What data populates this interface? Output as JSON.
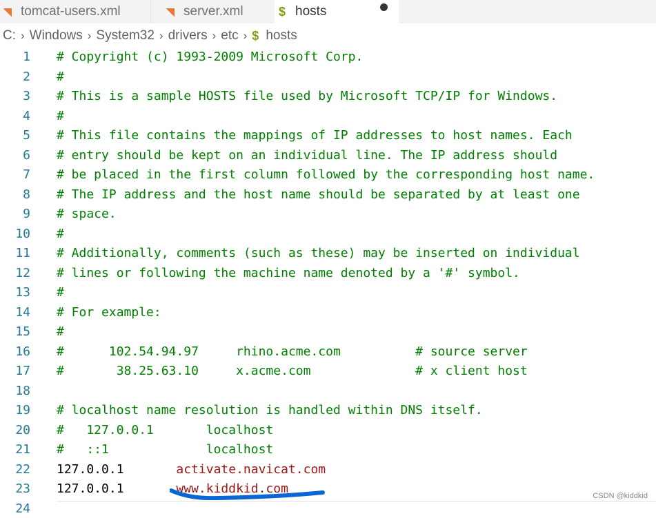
{
  "tabs": [
    {
      "label": "tomcat-users.xml",
      "icon": "rss-icon",
      "active": false
    },
    {
      "label": "server.xml",
      "icon": "rss-icon",
      "active": false
    },
    {
      "label": "hosts",
      "icon": "dollar-icon",
      "active": true,
      "dirty": true
    }
  ],
  "breadcrumb": {
    "items": [
      "C:",
      "Windows",
      "System32",
      "drivers",
      "etc",
      "hosts"
    ],
    "separator": "›"
  },
  "editor": {
    "lines": [
      {
        "n": "1",
        "text": "# Copyright (c) 1993-2009 Microsoft Corp.",
        "kind": "comment"
      },
      {
        "n": "2",
        "text": "#",
        "kind": "comment"
      },
      {
        "n": "3",
        "text": "# This is a sample HOSTS file used by Microsoft TCP/IP for Windows.",
        "kind": "comment"
      },
      {
        "n": "4",
        "text": "#",
        "kind": "comment"
      },
      {
        "n": "5",
        "text": "# This file contains the mappings of IP addresses to host names. Each",
        "kind": "comment"
      },
      {
        "n": "6",
        "text": "# entry should be kept on an individual line. The IP address should",
        "kind": "comment"
      },
      {
        "n": "7",
        "text": "# be placed in the first column followed by the corresponding host name.",
        "kind": "comment"
      },
      {
        "n": "8",
        "text": "# The IP address and the host name should be separated by at least one",
        "kind": "comment"
      },
      {
        "n": "9",
        "text": "# space.",
        "kind": "comment"
      },
      {
        "n": "10",
        "text": "#",
        "kind": "comment"
      },
      {
        "n": "11",
        "text": "# Additionally, comments (such as these) may be inserted on individual",
        "kind": "comment"
      },
      {
        "n": "12",
        "text": "# lines or following the machine name denoted by a '#' symbol.",
        "kind": "comment"
      },
      {
        "n": "13",
        "text": "#",
        "kind": "comment"
      },
      {
        "n": "14",
        "text": "# For example:",
        "kind": "comment"
      },
      {
        "n": "15",
        "text": "#",
        "kind": "comment"
      },
      {
        "n": "16",
        "text": "#      102.54.94.97     rhino.acme.com          # source server",
        "kind": "comment"
      },
      {
        "n": "17",
        "text": "#       38.25.63.10     x.acme.com              # x client host",
        "kind": "comment"
      },
      {
        "n": "18",
        "text": "",
        "kind": "comment"
      },
      {
        "n": "19",
        "text": "# localhost name resolution is handled within DNS itself.",
        "kind": "comment"
      },
      {
        "n": "20",
        "text": "#   127.0.0.1       localhost",
        "kind": "comment"
      },
      {
        "n": "21",
        "text": "#   ::1             localhost",
        "kind": "comment"
      },
      {
        "n": "22",
        "ip": "127.0.0.1       ",
        "host": "activate.navicat.com",
        "kind": "entry"
      },
      {
        "n": "23",
        "ip": "127.0.0.1       ",
        "host": "www.kiddkid.com",
        "kind": "entry"
      },
      {
        "n": "24",
        "text": "",
        "kind": "comment"
      }
    ]
  },
  "watermark": "CSDN @kiddkid",
  "colors": {
    "comment": "#008000",
    "line_number": "#237893",
    "host_name": "#a31515",
    "highlight_stroke": "#0a66d4"
  }
}
